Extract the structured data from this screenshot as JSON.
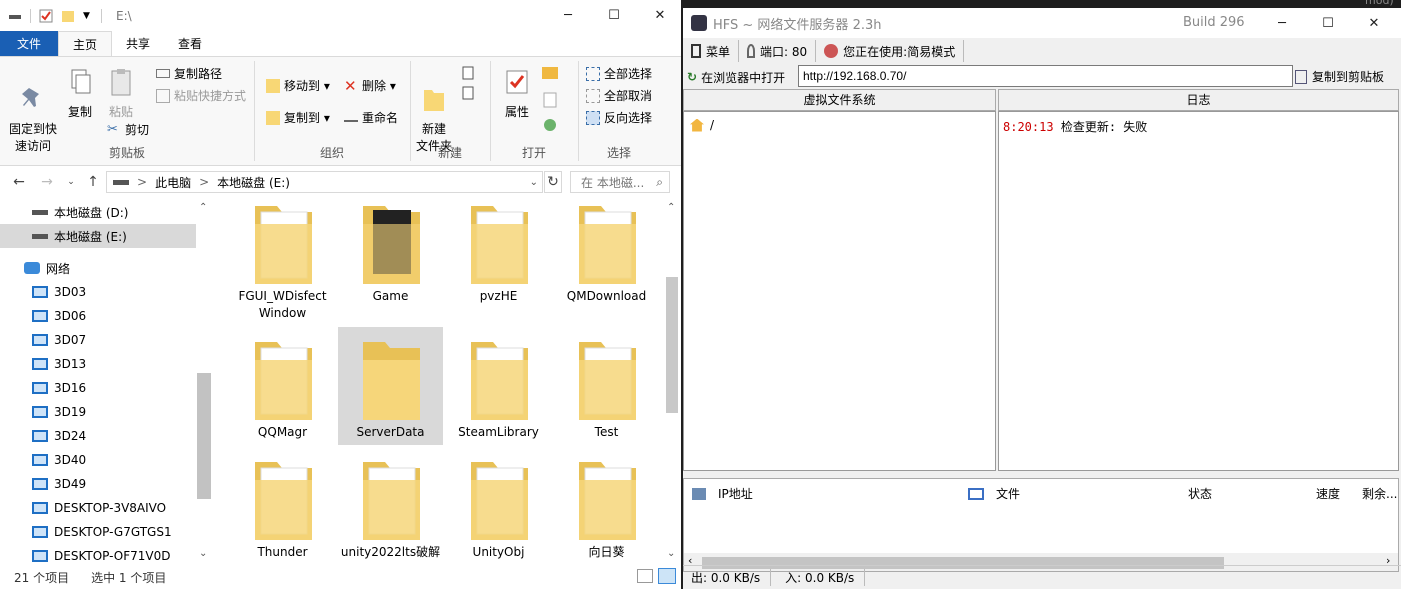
{
  "background": {
    "text": "mod) (zh-Hans)"
  },
  "explorer": {
    "title": "E:\\",
    "window_buttons": {
      "minimize": "─",
      "maximize": "☐",
      "close": "✕"
    },
    "tabs": {
      "file": "文件",
      "home": "主页",
      "share": "共享",
      "view": "查看"
    },
    "ribbon": {
      "pin_quick": "固定到快\n速访问",
      "copy": "复制",
      "paste": "粘贴",
      "copy_path": "复制路径",
      "paste_shortcut": "粘贴快捷方式",
      "cut": "剪切",
      "clipboard_label": "剪贴板",
      "move_to": "移动到",
      "delete": "删除",
      "copy_to": "复制到",
      "rename": "重命名",
      "organize_label": "组织",
      "new_folder": "新建\n文件夹",
      "new_label": "新建",
      "properties": "属性",
      "open_label": "打开",
      "select_all": "全部选择",
      "select_none": "全部取消",
      "invert": "反向选择",
      "select_label": "选择"
    },
    "address": {
      "pc": "此电脑",
      "drive": "本地磁盘 (E:)",
      "sep": ">",
      "search_placeholder": "在 本地磁..."
    },
    "nav": [
      {
        "label": "本地磁盘 (D:)"
      },
      {
        "label": "本地磁盘 (E:)"
      },
      {
        "label": "网络"
      },
      {
        "label": "3D03"
      },
      {
        "label": "3D06"
      },
      {
        "label": "3D07"
      },
      {
        "label": "3D13"
      },
      {
        "label": "3D16"
      },
      {
        "label": "3D19"
      },
      {
        "label": "3D24"
      },
      {
        "label": "3D40"
      },
      {
        "label": "3D49"
      },
      {
        "label": "DESKTOP-3V8AIVO"
      },
      {
        "label": "DESKTOP-G7GTGS1"
      },
      {
        "label": "DESKTOP-OF71V0D"
      }
    ],
    "folders": [
      {
        "name": "FGUI_WDisfect\nWindow"
      },
      {
        "name": "Game"
      },
      {
        "name": "pvzHE"
      },
      {
        "name": "QMDownload"
      },
      {
        "name": "QQMagr"
      },
      {
        "name": "ServerData"
      },
      {
        "name": "SteamLibrary"
      },
      {
        "name": "Test"
      },
      {
        "name": "Thunder"
      },
      {
        "name": "unity2022lts破解"
      },
      {
        "name": "UnityObj"
      },
      {
        "name": "向日葵"
      }
    ],
    "status": {
      "count": "21 个项目",
      "selected": "选中 1 个项目"
    }
  },
  "hfs": {
    "title": "HFS ~ 网络文件服务器 2.3h",
    "build": "Build 296",
    "window_buttons": {
      "minimize": "─",
      "maximize": "☐",
      "close": "✕"
    },
    "menu": {
      "menu": "菜单",
      "port": "端口: 80",
      "mode": "您正在使用:简易模式"
    },
    "open_in_browser": "在浏览器中打开",
    "url": "http://192.168.0.70/",
    "copy_clipboard": "复制到剪贴板",
    "vfs_header": "虚拟文件系统",
    "log_header": "日志",
    "vfs_root": "/",
    "log": {
      "time": "8:20:13",
      "msg": "检查更新: 失败"
    },
    "connections": {
      "ip": "IP地址",
      "file": "文件",
      "status": "状态",
      "speed": "速度",
      "remaining": "剩余..."
    },
    "status": {
      "out": "出: 0.0 KB/s",
      "in": "入: 0.0 KB/s"
    }
  }
}
